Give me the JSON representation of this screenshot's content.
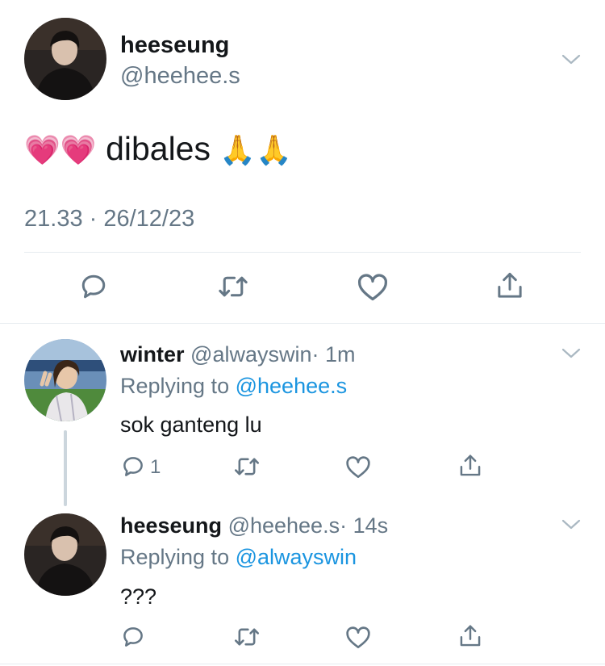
{
  "main_tweet": {
    "display_name": "heeseung",
    "handle": "@heehee.s",
    "text": "dibales",
    "emoji_leading": "💗💗",
    "emoji_trailing": "🙏🙏",
    "timestamp": "21.33 · 26/12/23"
  },
  "replies": [
    {
      "display_name": "winter",
      "handle": "@alwayswin",
      "time": "· 1m",
      "replying_label": "Replying to",
      "replying_to": "@heehee.s",
      "text": "sok ganteng lu",
      "reply_count": "1"
    },
    {
      "display_name": "heeseung",
      "handle": "@heehee.s",
      "time": "· 14s",
      "replying_label": "Replying to",
      "replying_to": "@alwayswin",
      "text": "???"
    }
  ],
  "icons": [
    "reply-icon",
    "retweet-icon",
    "like-icon",
    "share-icon",
    "chevron-down-icon"
  ],
  "colors": {
    "link": "#1b95e0",
    "muted": "#657786",
    "divider": "#e6ecf0"
  }
}
